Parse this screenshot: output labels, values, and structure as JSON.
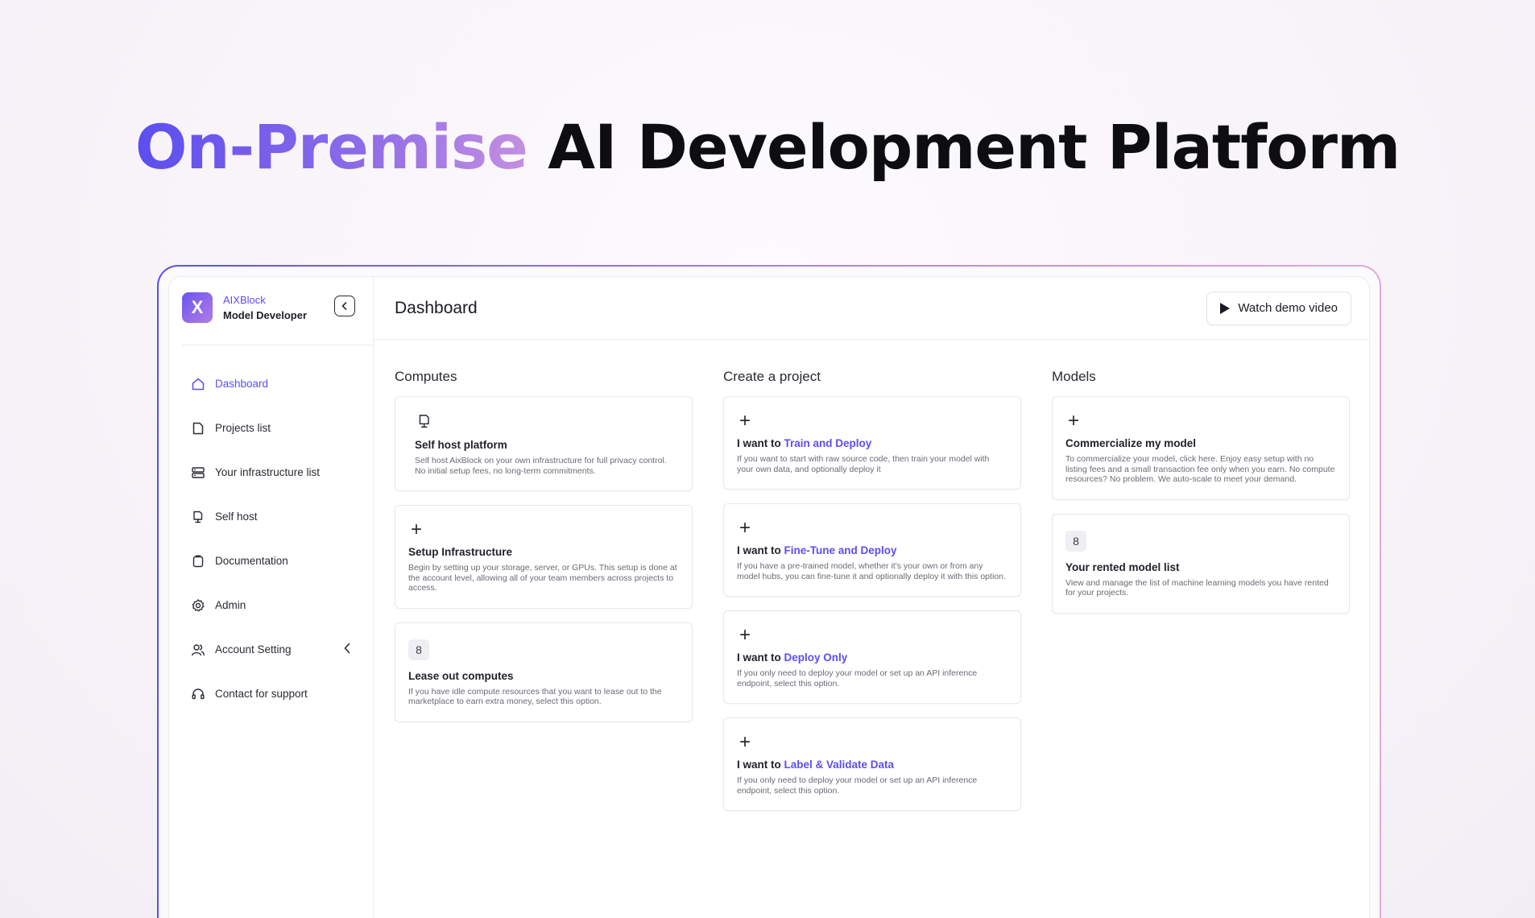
{
  "hero": {
    "highlight": "On-Premise",
    "rest": "AI Development Platform"
  },
  "colors": {
    "accent": "#5b4ef0",
    "gradient_start": "#5b4ef0",
    "gradient_end": "#c58fe0"
  },
  "sidebar": {
    "brand_name": "AIXBlock",
    "brand_role": "Model Developer",
    "logo_letter": "X",
    "items": [
      {
        "label": "Dashboard",
        "icon": "home-icon"
      },
      {
        "label": "Projects list",
        "icon": "file-icon"
      },
      {
        "label": "Your infrastructure list",
        "icon": "server-icon"
      },
      {
        "label": "Self host",
        "icon": "monitor-icon"
      },
      {
        "label": "Documentation",
        "icon": "clipboard-icon"
      },
      {
        "label": "Admin",
        "icon": "gear-icon"
      },
      {
        "label": "Account Setting",
        "icon": "users-icon"
      },
      {
        "label": "Contact for support",
        "icon": "headset-icon"
      }
    ]
  },
  "header": {
    "title": "Dashboard",
    "demo_button": "Watch demo video"
  },
  "computes": {
    "title": "Computes",
    "cards": [
      {
        "title": "Self host platform",
        "desc": "Self host AixBlock on your own infrastructure for full privacy control. No initial setup fees, no long-term commitments."
      },
      {
        "title": "Setup Infrastructure",
        "desc": "Begin by setting up your storage, server, or GPUs. This setup is done at the account level, allowing all of your team members across projects to access."
      },
      {
        "badge": "8",
        "title": "Lease out computes",
        "desc": "If you have idle compute resources that you want to lease out to the marketplace to earn extra money, select this option."
      }
    ]
  },
  "create": {
    "title": "Create a project",
    "prefix": "I want to",
    "cards": [
      {
        "accent": "Train and Deploy",
        "desc": "If you want to start with raw source code, then train your model with your own data, and optionally deploy it"
      },
      {
        "accent": "Fine-Tune and Deploy",
        "desc": "If you have a pre-trained model, whether it's your own or from any model hubs, you can fine-tune it and optionally deploy it with this option."
      },
      {
        "accent": "Deploy Only",
        "desc": "If you only need to deploy your model or set up an API inference endpoint, select this option."
      },
      {
        "accent": "Label & Validate Data",
        "desc": "If you only need to deploy your model or set up an API inference endpoint, select this option."
      }
    ]
  },
  "models": {
    "title": "Models",
    "cards": [
      {
        "title": "Commercialize my model",
        "desc": "To commercialize your model, click here. Enjoy easy setup with no listing fees and a small transaction fee only when you earn. No compute resources? No problem. We auto-scale to meet your demand."
      },
      {
        "badge": "8",
        "title": "Your rented model list",
        "desc": "View and manage the list of machine learning models you have rented for your projects."
      }
    ]
  }
}
